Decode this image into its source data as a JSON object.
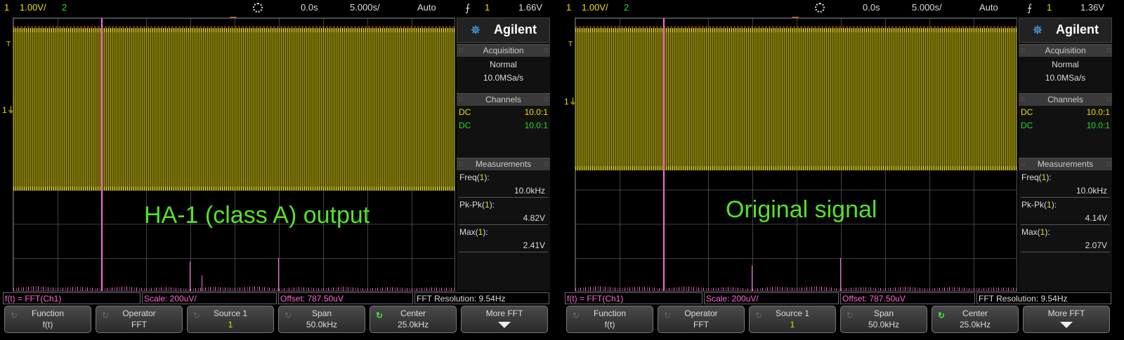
{
  "screens": [
    {
      "status": {
        "ch1": "1",
        "ch1_scale": "1.00V/",
        "ch2": "2",
        "time_pos": "0.0s",
        "time_scale": "5.000s/",
        "trigger_mode": "Auto",
        "trigger_icon": "rising-edge-icon",
        "trigger_channel": "1",
        "trigger_level": "1.66V"
      },
      "overlay_text": "HA-1 (class A) output",
      "panel": {
        "brand": "Agilent",
        "acquisition_header": "Acquisition",
        "acq_mode": "Normal",
        "acq_rate": "10.0MSa/s",
        "channels_header": "Channels",
        "channels": [
          {
            "coupling": "DC",
            "probe": "10.0:1",
            "color": "#e8e000"
          },
          {
            "coupling": "DC",
            "probe": "10.0:1",
            "color": "#22dd22"
          }
        ],
        "measurements_header": "Measurements",
        "measurements": [
          {
            "name": "Freq(",
            "ch": "1",
            "close": "):",
            "value": "10.0kHz"
          },
          {
            "name": "Pk-Pk(",
            "ch": "1",
            "close": "):",
            "value": "4.82V"
          },
          {
            "name": "Max(",
            "ch": "1",
            "close": "):",
            "value": "2.41V"
          }
        ]
      },
      "fn_bar": {
        "fx": "f(t) = FFT(Ch1)",
        "scale": "Scale: 200uV/",
        "offset": "Offset: 787.50uV",
        "resolution": "FFT Resolution: 9.54Hz"
      },
      "softkeys": [
        {
          "title": "Function",
          "sub": "f(t)"
        },
        {
          "title": "Operator",
          "sub": "FFT"
        },
        {
          "title": "Source 1",
          "sub": "1"
        },
        {
          "title": "Span",
          "sub": "50.0kHz"
        },
        {
          "title": "Center",
          "sub": "25.0kHz"
        },
        {
          "title": "More FFT",
          "sub": ""
        }
      ]
    },
    {
      "status": {
        "ch1": "1",
        "ch1_scale": "1.00V/",
        "ch2": "2",
        "time_pos": "0.0s",
        "time_scale": "5.000s/",
        "trigger_mode": "Auto",
        "trigger_icon": "rising-edge-icon",
        "trigger_channel": "1",
        "trigger_level": "1.36V"
      },
      "overlay_text": "Original signal",
      "panel": {
        "brand": "Agilent",
        "acquisition_header": "Acquisition",
        "acq_mode": "Normal",
        "acq_rate": "10.0MSa/s",
        "channels_header": "Channels",
        "channels": [
          {
            "coupling": "DC",
            "probe": "10.0:1",
            "color": "#e8e000"
          },
          {
            "coupling": "DC",
            "probe": "10.0:1",
            "color": "#22dd22"
          }
        ],
        "measurements_header": "Measurements",
        "measurements": [
          {
            "name": "Freq(",
            "ch": "1",
            "close": "):",
            "value": "10.0kHz"
          },
          {
            "name": "Pk-Pk(",
            "ch": "1",
            "close": "):",
            "value": "4.14V"
          },
          {
            "name": "Max(",
            "ch": "1",
            "close": "):",
            "value": "2.07V"
          }
        ]
      },
      "fn_bar": {
        "fx": "f(t) = FFT(Ch1)",
        "scale": "Scale: 200uV/",
        "offset": "Offset: 787.50uV",
        "resolution": "FFT Resolution: 9.54Hz"
      },
      "softkeys": [
        {
          "title": "Function",
          "sub": "f(t)"
        },
        {
          "title": "Operator",
          "sub": "FFT"
        },
        {
          "title": "Source 1",
          "sub": "1"
        },
        {
          "title": "Span",
          "sub": "50.0kHz"
        },
        {
          "title": "Center",
          "sub": "25.0kHz"
        },
        {
          "title": "More FFT",
          "sub": ""
        }
      ]
    }
  ]
}
